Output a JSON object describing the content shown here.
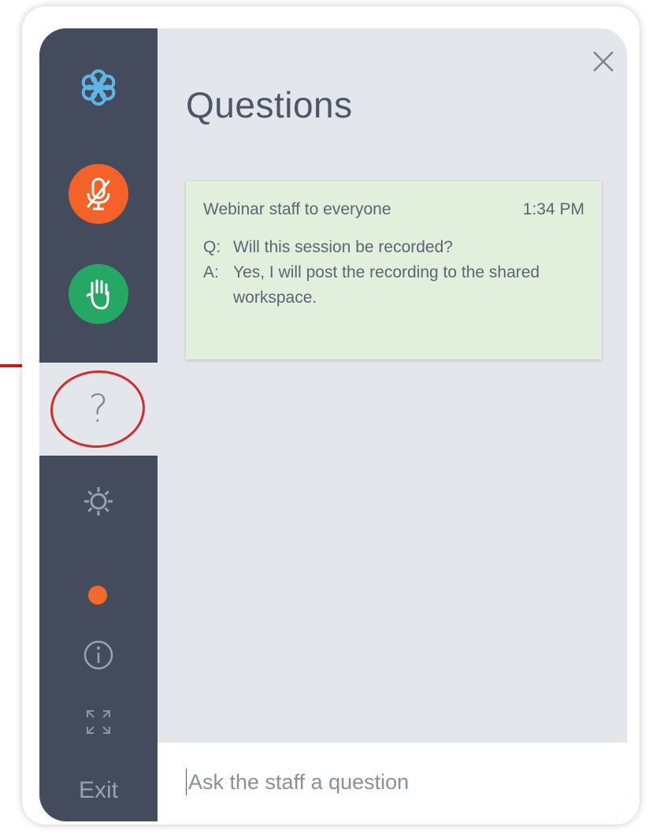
{
  "sidebar": {
    "exit_label": "Exit",
    "help_glyph": "?",
    "icons": [
      "logo-icon",
      "mic-muted-icon",
      "raise-hand-icon",
      "question-icon",
      "gear-icon",
      "status-dot",
      "info-icon",
      "expand-icon"
    ],
    "colors": {
      "background": "#434b5c",
      "mute": "#f4622a",
      "hand": "#25a863",
      "status_dot": "#f26a2b",
      "highlight_circle": "#d42b2b"
    }
  },
  "panel": {
    "title": "Questions",
    "close_icon": "close-icon",
    "card": {
      "sender": "Webinar staff to everyone",
      "time": "1:34 PM",
      "question_label": "Q:",
      "question": "Will this session be recorded?",
      "answer_label": "A:",
      "answer": "Yes, I will post the recording to the shared workspace.",
      "background": "#e3efdd"
    },
    "input": {
      "placeholder": "Ask the staff a question"
    }
  }
}
